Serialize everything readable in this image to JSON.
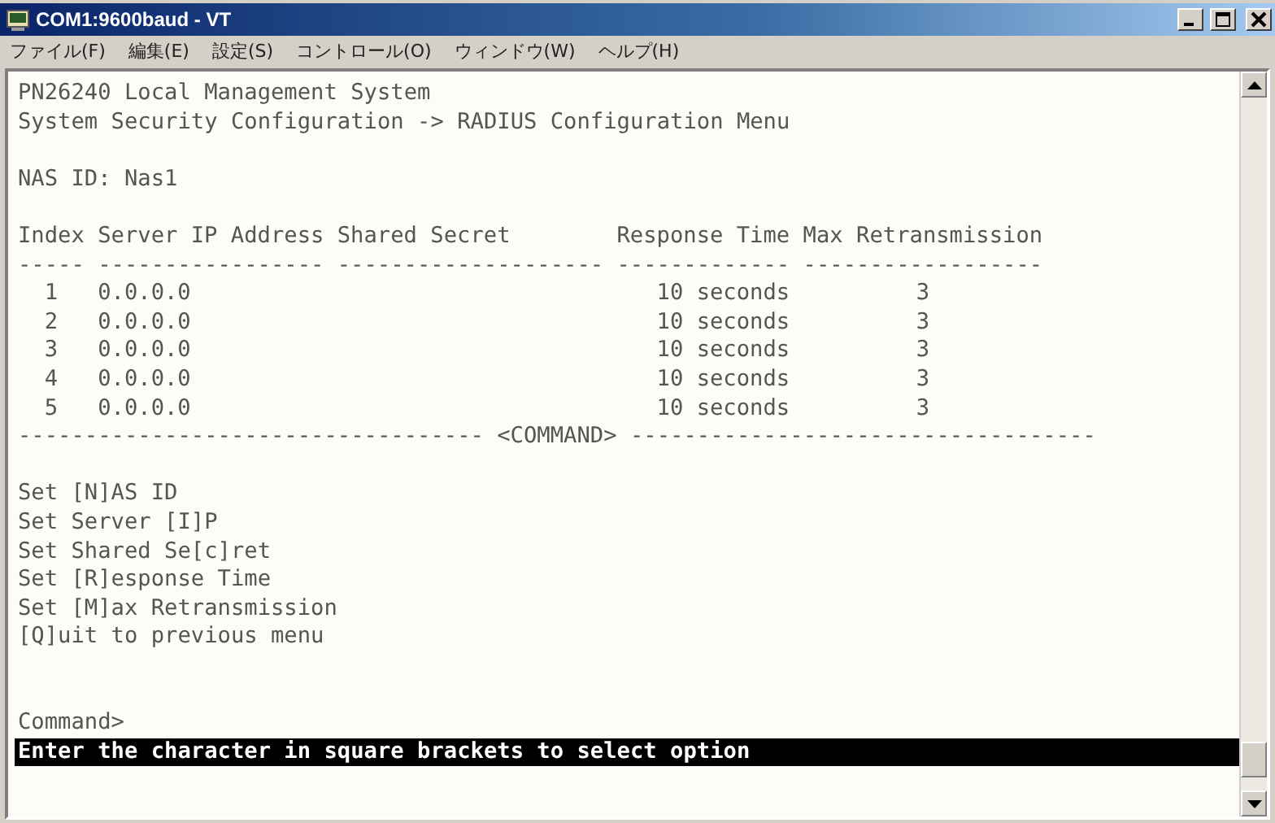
{
  "window": {
    "title": "COM1:9600baud - VT"
  },
  "menu": [
    "ファイル(F)",
    "編集(E)",
    "設定(S)",
    "コントロール(O)",
    "ウィンドウ(W)",
    "ヘルプ(H)"
  ],
  "terminal": {
    "header_lines": [
      "PN26240 Local Management System",
      "System Security Configuration -> RADIUS Configuration Menu"
    ],
    "nas_id": "NAS ID: Nas1",
    "table": {
      "columns": [
        "Index",
        "Server IP Address",
        "Shared Secret",
        "Response Time",
        "Max Retransmission"
      ],
      "underlines": [
        "-----",
        "-----------------",
        "--------------------",
        "-------------",
        "------------------"
      ],
      "rows": [
        {
          "index": "1",
          "ip": "0.0.0.0",
          "secret": "",
          "response": "10 seconds",
          "max": "3"
        },
        {
          "index": "2",
          "ip": "0.0.0.0",
          "secret": "",
          "response": "10 seconds",
          "max": "3"
        },
        {
          "index": "3",
          "ip": "0.0.0.0",
          "secret": "",
          "response": "10 seconds",
          "max": "3"
        },
        {
          "index": "4",
          "ip": "0.0.0.0",
          "secret": "",
          "response": "10 seconds",
          "max": "3"
        },
        {
          "index": "5",
          "ip": "0.0.0.0",
          "secret": "",
          "response": "10 seconds",
          "max": "3"
        }
      ]
    },
    "divider": {
      "left": "-----------------------------------",
      "label": "<COMMAND>",
      "right": "-----------------------------------"
    },
    "options": [
      "Set [N]AS ID",
      "Set Server [I]P",
      "Set Shared Se[c]ret",
      "Set [R]esponse Time",
      "Set [M]ax Retransmission",
      "[Q]uit to previous menu"
    ],
    "prompt": "Command>",
    "status_line": "Enter the character in square brackets to select option"
  }
}
